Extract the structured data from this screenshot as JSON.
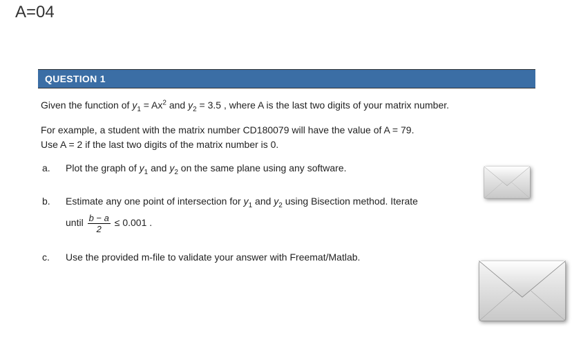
{
  "header": {
    "label": "A=04"
  },
  "question": {
    "banner": "QUESTION 1",
    "intro_p1_pre": "Given the function of ",
    "intro_p1_eq1_lhs": "y",
    "intro_p1_eq1_sub": "1",
    "intro_p1_eq1_mid": " = Ax",
    "intro_p1_eq1_sup": "2",
    "intro_p1_and": " and ",
    "intro_p1_eq2_lhs": "y",
    "intro_p1_eq2_sub": "2",
    "intro_p1_eq2_rhs": " = 3.5",
    "intro_p1_post": ", where A is the last two digits of your matrix number.",
    "intro_p2_l1": "For example, a student with the matrix number CD180079 will have the value of A = 79.",
    "intro_p2_l2": "Use A = 2 if the last two digits of the matrix number is 0.",
    "items": {
      "a": {
        "label": "a.",
        "pre": "Plot the graph of ",
        "v1": "y",
        "s1": "1",
        "and": " and ",
        "v2": "y",
        "s2": "2",
        "post": " on the same plane using any software."
      },
      "b": {
        "label": "b.",
        "l1_pre": "Estimate any one point of intersection for ",
        "l1_v1": "y",
        "l1_s1": "1",
        "l1_and": " and ",
        "l1_v2": "y",
        "l1_s2": "2",
        "l1_post": " using Bisection method. Iterate",
        "l2_pre": "until ",
        "frac_num": "b − a",
        "frac_den": "2",
        "l2_op": " ≤ ",
        "l2_val": "0.001",
        "l2_period": "."
      },
      "c": {
        "label": "c.",
        "text": "Use the provided m-file to validate your answer with Freemat/Matlab."
      }
    }
  },
  "icons": {
    "envelope_small": "envelope-icon",
    "envelope_large": "envelope-icon"
  }
}
